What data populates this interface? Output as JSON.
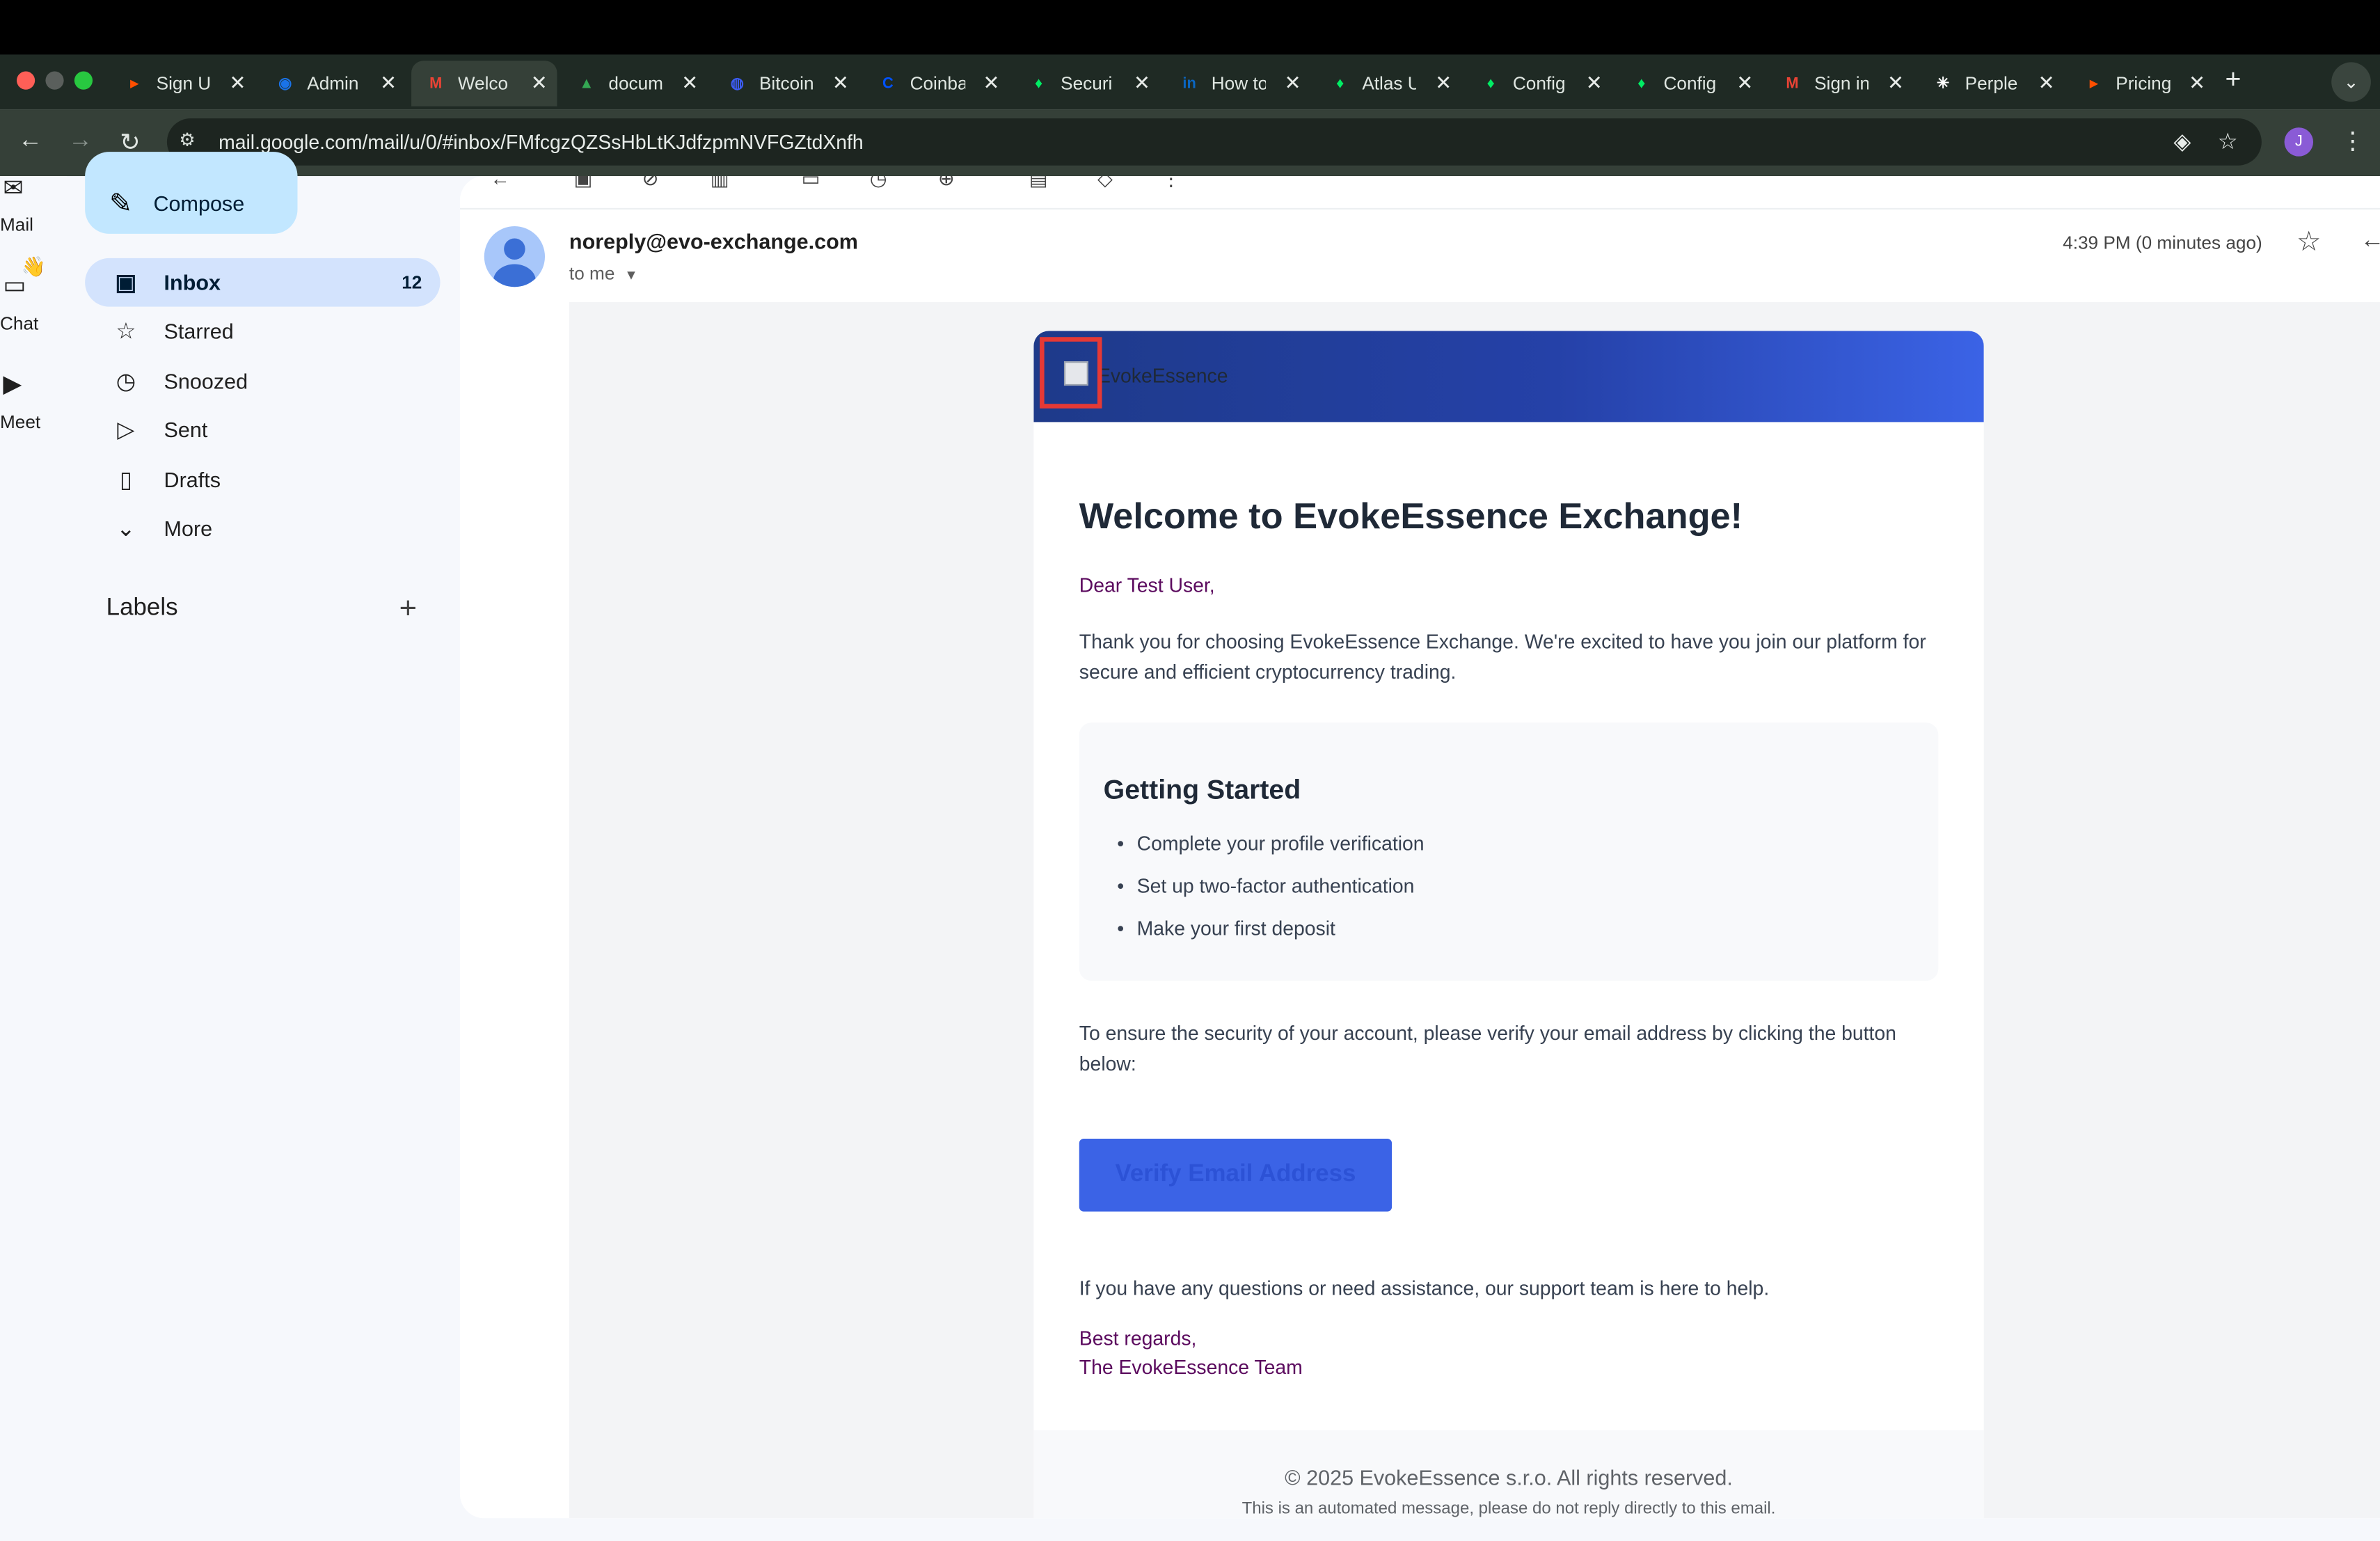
{
  "browser": {
    "tabs": [
      {
        "label": "Sign U",
        "icon": "zapier-icon",
        "color": "#ff4f00"
      },
      {
        "label": "Admin",
        "icon": "admin-icon",
        "color": "#1a73e8"
      },
      {
        "label": "Welco",
        "icon": "gmail-icon",
        "color": "#ea4335",
        "active": true
      },
      {
        "label": "docum",
        "icon": "drive-icon",
        "color": "#34a853"
      },
      {
        "label": "Bitcoin",
        "icon": "bitcoin-icon",
        "color": "#3c5cf0"
      },
      {
        "label": "Coinba",
        "icon": "coinbase-icon",
        "color": "#0052ff"
      },
      {
        "label": "Securi",
        "icon": "mongodb-icon",
        "color": "#00ed64"
      },
      {
        "label": "How to",
        "icon": "linkedin-icon",
        "color": "#0a66c2"
      },
      {
        "label": "Atlas U",
        "icon": "mongodb-icon",
        "color": "#00ed64"
      },
      {
        "label": "Config",
        "icon": "mongodb-icon",
        "color": "#00ed64"
      },
      {
        "label": "Config",
        "icon": "mongodb-icon",
        "color": "#00ed64"
      },
      {
        "label": "Sign in",
        "icon": "gmail-icon",
        "color": "#ea4335"
      },
      {
        "label": "Perple",
        "icon": "perplexity-icon",
        "color": "#ffffff"
      },
      {
        "label": "Pricing",
        "icon": "zapier-icon",
        "color": "#ff4f00"
      }
    ],
    "url": "mail.google.com/mail/u/0/#inbox/FMfcgzQZSsHbLtKJdfzpmNVFGZtdXnfh",
    "profile_initial": "J"
  },
  "rail": {
    "mail_label": "Mail",
    "chat_label": "Chat",
    "meet_label": "Meet"
  },
  "nav": {
    "compose_label": "Compose",
    "items": [
      {
        "label": "Inbox",
        "icon": "inbox-icon",
        "count": "12"
      },
      {
        "label": "Starred",
        "icon": "star-icon"
      },
      {
        "label": "Snoozed",
        "icon": "clock-icon"
      },
      {
        "label": "Sent",
        "icon": "send-icon"
      },
      {
        "label": "Drafts",
        "icon": "draft-icon"
      },
      {
        "label": "More",
        "icon": "chevron-down-icon"
      }
    ],
    "labels_heading": "Labels"
  },
  "message": {
    "sender": "noreply@evo-exchange.com",
    "to": "to me",
    "time": "4:39 PM (0 minutes ago)"
  },
  "email": {
    "logo_alt": "EvokeEssence",
    "heading": "Welcome to EvokeEssence Exchange!",
    "greeting": "Dear Test User,",
    "intro": "Thank you for choosing EvokeEssence Exchange. We're excited to have you join our platform for secure and efficient cryptocurrency trading.",
    "getting_started_title": "Getting Started",
    "steps": [
      "Complete your profile verification",
      "Set up two-factor authentication",
      "Make your first deposit"
    ],
    "security_text": "To ensure the security of your account, please verify your email address by clicking the button below:",
    "verify_button": "Verify Email Address",
    "help_text": "If you have any questions or need assistance, our support team is here to help.",
    "closing": "Best regards,",
    "signature": "The EvokeEssence Team",
    "copyright": "© 2025 EvokeEssence s.r.o. All rights reserved.",
    "automated_notice": "This is an automated message, please do not reply directly to this email."
  }
}
